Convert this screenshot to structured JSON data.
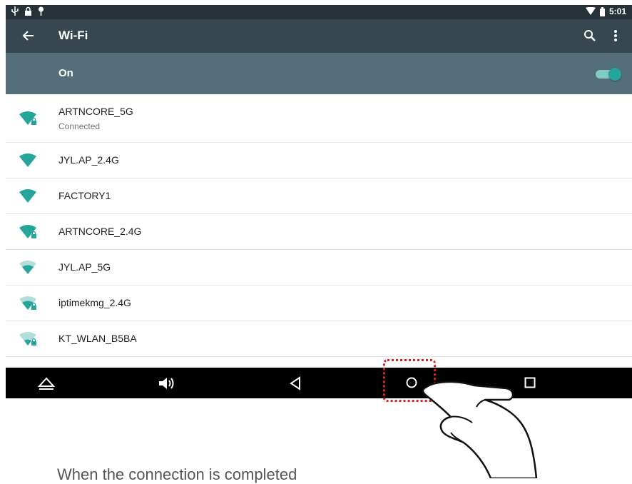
{
  "status_bar": {
    "time": "5:01",
    "left_icons": [
      "usb-icon",
      "lock-icon",
      "notification-icon"
    ],
    "right_icons": [
      "wifi-signal-icon",
      "battery-icon"
    ]
  },
  "toolbar": {
    "title": "Wi-Fi"
  },
  "wifi_toggle": {
    "label": "On",
    "state": "on"
  },
  "networks": [
    {
      "ssid": "ARTNCORE_5G",
      "status": "Connected",
      "signal": "full",
      "locked": true
    },
    {
      "ssid": "JYL.AP_2.4G",
      "signal": "full",
      "locked": false
    },
    {
      "ssid": "FACTORY1",
      "signal": "full",
      "locked": false
    },
    {
      "ssid": "ARTNCORE_2.4G",
      "signal": "full",
      "locked": true
    },
    {
      "ssid": "JYL.AP_5G",
      "signal": "medium",
      "locked": false
    },
    {
      "ssid": "iptimekmg_2.4G",
      "signal": "medium",
      "locked": true
    },
    {
      "ssid": "KT_WLAN_B5BA",
      "signal": "low",
      "locked": true
    }
  ],
  "nav_bar": {
    "buttons": [
      "eject-icon",
      "volume-icon",
      "back-icon",
      "home-icon",
      "recents-icon"
    ]
  },
  "caption": "When the connection is completed",
  "colors": {
    "teal": "#26a69a",
    "status_bar": "#263238",
    "toolbar": "#37474f",
    "toggle_bar": "#546e7a"
  }
}
